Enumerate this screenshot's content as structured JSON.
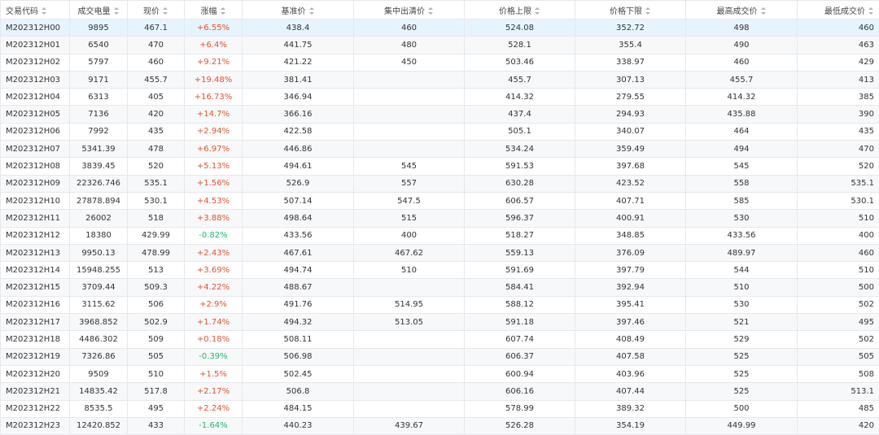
{
  "colors": {
    "rise": "#e4512e",
    "fall": "#1fb86a",
    "selected_row": "#e6f4fd"
  },
  "headers": [
    "交易代码",
    "成交电量",
    "现价",
    "涨幅",
    "基准价",
    "集中出清价",
    "价格上限",
    "价格下限",
    "最高成交价",
    "最低成交价"
  ],
  "rows": [
    [
      "M202312H00",
      "9895",
      "467.1",
      "+6.55%",
      "438.4",
      "460",
      "524.08",
      "352.72",
      "498",
      "460"
    ],
    [
      "M202312H01",
      "6540",
      "470",
      "+6.4%",
      "441.75",
      "480",
      "528.1",
      "355.4",
      "490",
      "463"
    ],
    [
      "M202312H02",
      "5797",
      "460",
      "+9.21%",
      "421.22",
      "450",
      "503.46",
      "338.97",
      "460",
      "429"
    ],
    [
      "M202312H03",
      "9171",
      "455.7",
      "+19.48%",
      "381.41",
      "",
      "455.7",
      "307.13",
      "455.7",
      "413"
    ],
    [
      "M202312H04",
      "6313",
      "405",
      "+16.73%",
      "346.94",
      "",
      "414.32",
      "279.55",
      "414.32",
      "385"
    ],
    [
      "M202312H05",
      "7136",
      "420",
      "+14.7%",
      "366.16",
      "",
      "437.4",
      "294.93",
      "435.88",
      "390"
    ],
    [
      "M202312H06",
      "7992",
      "435",
      "+2.94%",
      "422.58",
      "",
      "505.1",
      "340.07",
      "464",
      "435"
    ],
    [
      "M202312H07",
      "5341.39",
      "478",
      "+6.97%",
      "446.86",
      "",
      "534.24",
      "359.49",
      "494",
      "470"
    ],
    [
      "M202312H08",
      "3839.45",
      "520",
      "+5.13%",
      "494.61",
      "545",
      "591.53",
      "397.68",
      "545",
      "520"
    ],
    [
      "M202312H09",
      "22326.746",
      "535.1",
      "+1.56%",
      "526.9",
      "557",
      "630.28",
      "423.52",
      "558",
      "535.1"
    ],
    [
      "M202312H10",
      "27878.894",
      "530.1",
      "+4.53%",
      "507.14",
      "547.5",
      "606.57",
      "407.71",
      "585",
      "530.1"
    ],
    [
      "M202312H11",
      "26002",
      "518",
      "+3.88%",
      "498.64",
      "515",
      "596.37",
      "400.91",
      "530",
      "510"
    ],
    [
      "M202312H12",
      "18380",
      "429.99",
      "-0.82%",
      "433.56",
      "400",
      "518.27",
      "348.85",
      "433.56",
      "400"
    ],
    [
      "M202312H13",
      "9950.13",
      "478.99",
      "+2.43%",
      "467.61",
      "467.62",
      "559.13",
      "376.09",
      "489.97",
      "460"
    ],
    [
      "M202312H14",
      "15948.255",
      "513",
      "+3.69%",
      "494.74",
      "510",
      "591.69",
      "397.79",
      "544",
      "510"
    ],
    [
      "M202312H15",
      "3709.44",
      "509.3",
      "+4.22%",
      "488.67",
      "",
      "584.41",
      "392.94",
      "510",
      "500"
    ],
    [
      "M202312H16",
      "3115.62",
      "506",
      "+2.9%",
      "491.76",
      "514.95",
      "588.12",
      "395.41",
      "530",
      "502"
    ],
    [
      "M202312H17",
      "3968.852",
      "502.9",
      "+1.74%",
      "494.32",
      "513.05",
      "591.18",
      "397.46",
      "521",
      "495"
    ],
    [
      "M202312H18",
      "4486.302",
      "509",
      "+0.18%",
      "508.11",
      "",
      "607.74",
      "408.49",
      "529",
      "502"
    ],
    [
      "M202312H19",
      "7326.86",
      "505",
      "-0.39%",
      "506.98",
      "",
      "606.37",
      "407.58",
      "525",
      "505"
    ],
    [
      "M202312H20",
      "9509",
      "510",
      "+1.5%",
      "502.45",
      "",
      "600.94",
      "403.96",
      "525",
      "508"
    ],
    [
      "M202312H21",
      "14835.42",
      "517.8",
      "+2.17%",
      "506.8",
      "",
      "606.16",
      "407.44",
      "525",
      "513.1"
    ],
    [
      "M202312H22",
      "8535.5",
      "495",
      "+2.24%",
      "484.15",
      "",
      "578.99",
      "389.32",
      "500",
      "485"
    ],
    [
      "M202312H23",
      "12420.852",
      "433",
      "-1.64%",
      "440.23",
      "439.67",
      "526.28",
      "354.19",
      "449.99",
      "420"
    ]
  ]
}
